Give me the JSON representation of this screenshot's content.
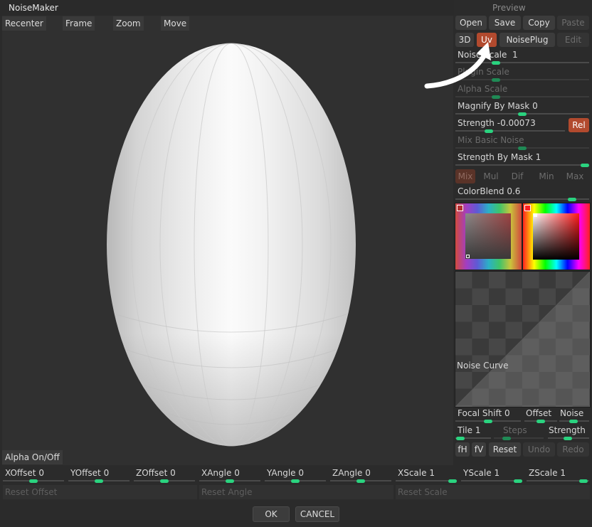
{
  "window": {
    "title": "NoiseMaker"
  },
  "viewport": {
    "toolbar": [
      "Recenter",
      "Frame",
      "Zoom",
      "Move"
    ],
    "alpha_toggle": "Alpha On/Off"
  },
  "panel": {
    "preview_label": "Preview",
    "file_buttons": [
      "Open",
      "Save",
      "Copy",
      "Paste"
    ],
    "mode_buttons": [
      "3D",
      "Uv",
      "NoisePlug",
      "Edit"
    ],
    "noise_scale": {
      "label": "Noise Scale",
      "value": "1",
      "level": 0.29
    },
    "plugin_scale": {
      "label": "Plugin Scale",
      "level": 0.29
    },
    "alpha_scale": {
      "label": "Alpha Scale",
      "level": 0.29
    },
    "magnify_by_mask": {
      "label": "Magnify By Mask",
      "value": "0",
      "level": 0.5
    },
    "strength": {
      "label": "Strength",
      "value": "-0.00073",
      "level": 0.29
    },
    "rel_button": "Rel",
    "mix_basic_noise": {
      "label": "Mix Basic Noise",
      "level": 0.5
    },
    "strength_by_mask": {
      "label": "Strength By Mask",
      "value": "1",
      "level": 1.0
    },
    "blend_modes": [
      "Mix",
      "Mul",
      "Dif",
      "Min",
      "Max"
    ],
    "color_blend": {
      "label": "ColorBlend",
      "value": "0.6",
      "level": 0.9
    },
    "noise_curve_label": "Noise Curve",
    "focal_shift": {
      "label": "Focal Shift",
      "value": "0"
    },
    "offset_label": "Offset",
    "noise_label": "Noise",
    "tile": {
      "label": "Tile",
      "value": "1"
    },
    "steps_label": "Steps",
    "strength_label2": "Strength",
    "curve_buttons": [
      "fH",
      "fV",
      "Reset",
      "Undo",
      "Redo"
    ]
  },
  "transform": {
    "sliders": [
      {
        "label": "XOffset",
        "value": "0"
      },
      {
        "label": "YOffset",
        "value": "0"
      },
      {
        "label": "ZOffset",
        "value": "0"
      },
      {
        "label": "XAngle",
        "value": "0"
      },
      {
        "label": "YAngle",
        "value": "0"
      },
      {
        "label": "ZAngle",
        "value": "0"
      },
      {
        "label": "XScale",
        "value": "1"
      },
      {
        "label": "YScale",
        "value": "1"
      },
      {
        "label": "ZScale",
        "value": "1"
      }
    ],
    "reset_buttons": [
      "Reset Offset",
      "Reset Angle",
      "Reset Scale"
    ]
  },
  "dialog": {
    "ok": "OK",
    "cancel": "CANCEL"
  },
  "colors": {
    "accent_green": "#2ad37f",
    "accent_red": "#b24a2e",
    "arrow": "#ffffff"
  }
}
